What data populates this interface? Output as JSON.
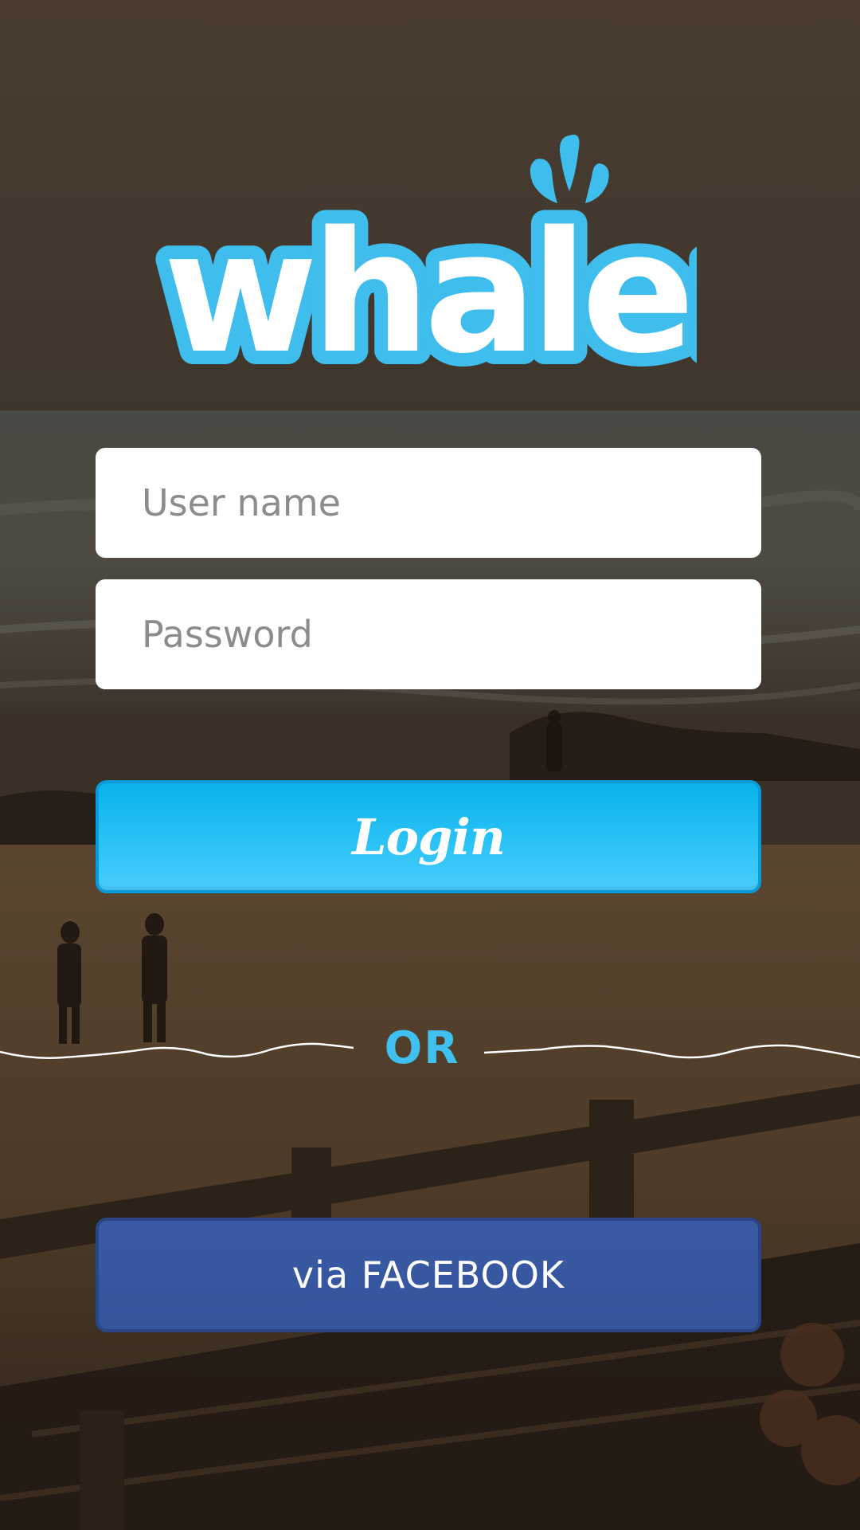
{
  "app": {
    "logo_text": "whaler"
  },
  "login_form": {
    "username_placeholder": "User name",
    "username_value": "",
    "password_placeholder": "Password",
    "password_value": "",
    "login_label": "Login"
  },
  "divider": {
    "label": "OR"
  },
  "social": {
    "facebook_label": "via FACEBOOK"
  },
  "colors": {
    "brand_blue": "#3fc0f0",
    "login_button": "#1ab9f2",
    "facebook_blue": "#3a5ba4",
    "input_background": "#ffffff",
    "placeholder_text": "#8c8c8c"
  },
  "icons": {
    "logo": "whale-logo-icon",
    "divider_waves": "wave-line-icon"
  }
}
